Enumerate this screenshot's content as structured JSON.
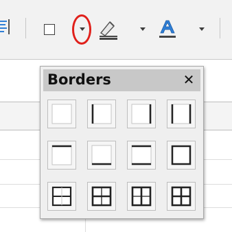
{
  "popup": {
    "title": "Borders",
    "close_symbol": "✕"
  },
  "toolbar": {
    "icons": [
      "paragraph-align-icon",
      "borders-icon",
      "dropdown-arrow-icon",
      "line-style-icon",
      "font-color-icon"
    ],
    "highlight_color": "#e0201b",
    "accent_color": "#2f7fd6"
  },
  "border_presets": [
    "no-borders",
    "left-border",
    "right-border",
    "left-right-borders",
    "top-border",
    "bottom-border",
    "top-bottom-borders",
    "outer-border",
    "horizontal-borders",
    "outer-and-horizontal",
    "outer-and-vertical",
    "all-borders"
  ]
}
